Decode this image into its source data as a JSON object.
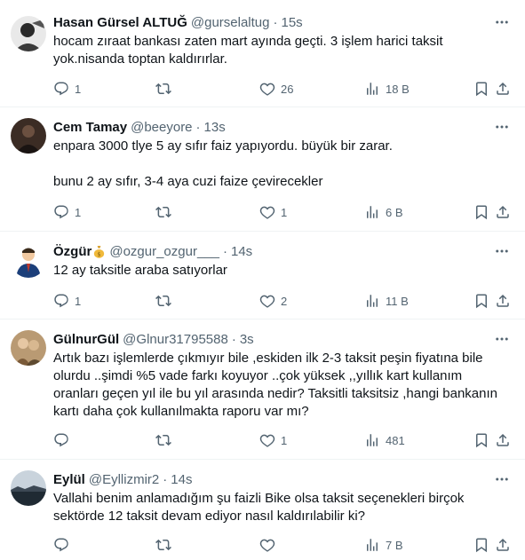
{
  "tweets": [
    {
      "name": "Hasan Gürsel ALTUĞ",
      "handle": "@gurselaltug",
      "sep": "·",
      "time": "15s",
      "text": "hocam zıraat bankası zaten mart ayında geçti. 3 işlem harici taksit yok.nisanda toptan kaldırırlar.",
      "replies": "1",
      "retweets": "",
      "likes": "26",
      "views": "18 B"
    },
    {
      "name": "Cem Tamay",
      "handle": "@beeyore",
      "sep": "·",
      "time": "13s",
      "text": "enpara 3000 tlye 5 ay sıfır faiz yapıyordu. büyük bir zarar.\n\nbunu 2 ay sıfır, 3-4 aya cuzi faize çevirecekler",
      "replies": "1",
      "retweets": "",
      "likes": "1",
      "views": "6 B"
    },
    {
      "name": "Özgür",
      "handle": "@ozgur_ozgur___",
      "sep": "·",
      "time": "14s",
      "text": "12 ay taksitle araba satıyorlar",
      "replies": "1",
      "retweets": "",
      "likes": "2",
      "views": "11 B"
    },
    {
      "name": "GülnurGül",
      "handle": "@Glnur31795588",
      "sep": "·",
      "time": "3s",
      "text": "Artık bazı işlemlerde çıkmıyır bile ,eskiden ilk 2-3 taksit peşin fiyatına bile olurdu ..şimdi %5 vade farkı koyuyor ..çok yüksek ,,yıllık kart kullanım oranları geçen yıl ile bu yıl arasında nedir? Taksitli taksitsiz ,hangi bankanın kartı daha çok kullanılmakta raporu var mı?",
      "replies": "",
      "retweets": "",
      "likes": "1",
      "views": "481"
    },
    {
      "name": "Eylül",
      "handle": "@Eyllizmir2",
      "sep": "·",
      "time": "14s",
      "text": "Vallahi benim anlamadığım şu faizli Bike olsa taksit seçenekleri birçok sektörde 12 taksit devam ediyor nasıl kaldırılabilir ki?",
      "replies": "",
      "retweets": "",
      "likes": "",
      "views": "7 B"
    }
  ]
}
